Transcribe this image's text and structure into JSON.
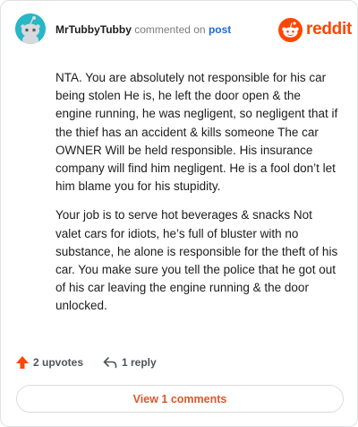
{
  "header": {
    "username": "MrTubbyTubby",
    "action_text": "commented on",
    "post_link": "post",
    "brand": "reddit"
  },
  "comment": {
    "paragraphs": [
      "NTA. You are absolutely not responsible for his car being stolen He is, he left the door open & the engine running, he was negligent, so negligent that if the thief has an accident & kills someone The car OWNER Will be held responsible. His insurance company will find him negligent. He is a fool don’t let him blame you for his stupidity.",
      "Your job is to serve hot beverages & snacks Not valet cars for idiots, he’s full of bluster with no substance, he alone is responsible for the theft of his car. You make sure you tell the police that he got out of his car leaving the engine running & the door unlocked."
    ]
  },
  "actions": {
    "upvotes": "2 upvotes",
    "replies": "1 reply"
  },
  "view_comments_label": "View 1 comments",
  "icons": {
    "upvote": "upvote-arrow-icon",
    "reply": "reply-arrow-icon",
    "avatar": "snoo-avatar-icon",
    "brand": "reddit-logo-icon"
  },
  "colors": {
    "accent": "#ff4500",
    "link": "#1c6bd6",
    "avatar_bg": "#27b7c7",
    "view_button_text": "#e0562a"
  }
}
